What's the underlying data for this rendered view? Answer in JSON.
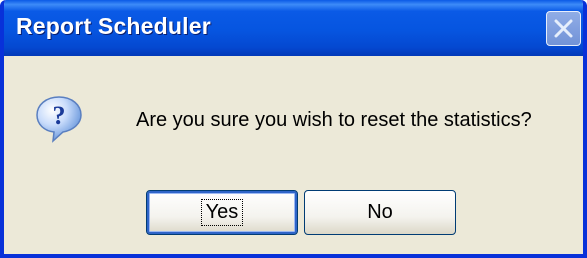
{
  "dialog": {
    "title": "Report Scheduler",
    "message": "Are you sure you wish to reset the statistics?",
    "icon": "question-icon",
    "buttons": {
      "yes_label": "Yes",
      "no_label": "No"
    },
    "close_icon": "close-icon"
  },
  "colors": {
    "titlebar": "#0a5ae6",
    "window_face": "#ece9d8",
    "frame": "#0831d9"
  }
}
